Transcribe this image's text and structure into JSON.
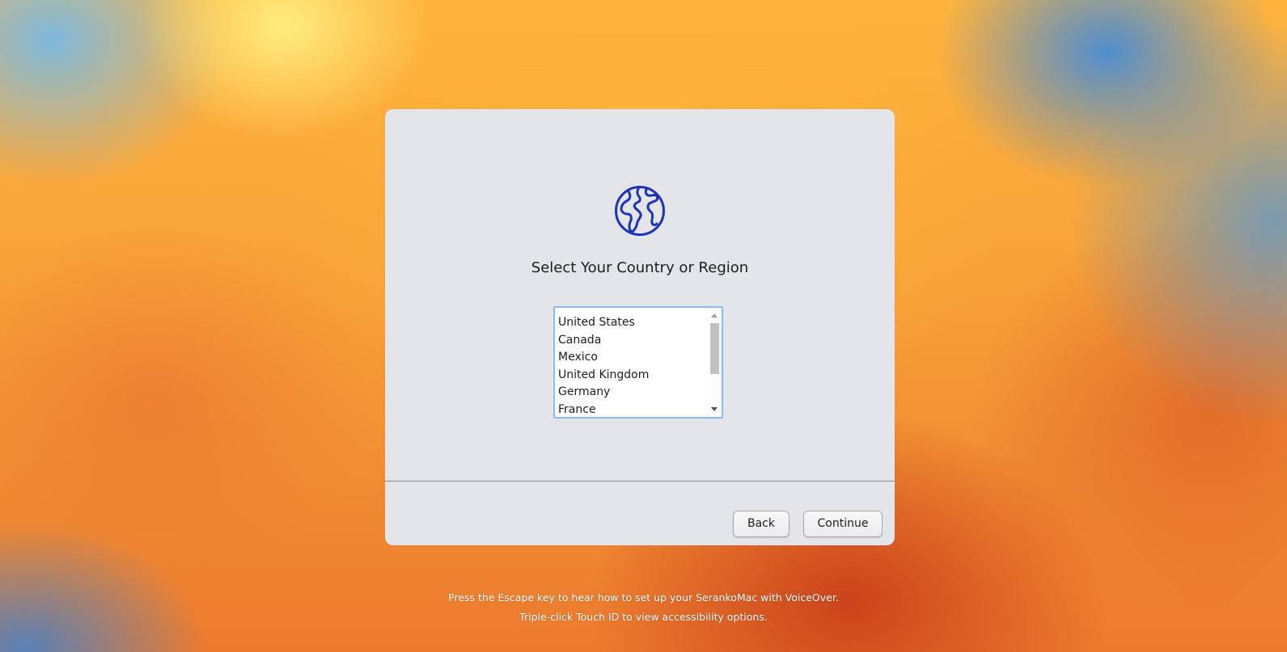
{
  "dialog": {
    "icon": "globe-icon",
    "title": "Select Your Country or Region",
    "countries": [
      "United States",
      "Canada",
      "Mexico",
      "United Kingdom",
      "Germany",
      "France"
    ],
    "buttons": {
      "back_label": "Back",
      "continue_label": "Continue"
    }
  },
  "footer": {
    "voiceover_hint": "Press the Escape key to hear how to set up your SerankoMac with VoiceOver.",
    "accessibility_hint": "Triple-click Touch ID to view accessibility options."
  },
  "colors": {
    "icon_blue": "#1e32b4",
    "list_focus_ring": "#8ab9f5",
    "dialog_bg": "#e4e5e9"
  }
}
